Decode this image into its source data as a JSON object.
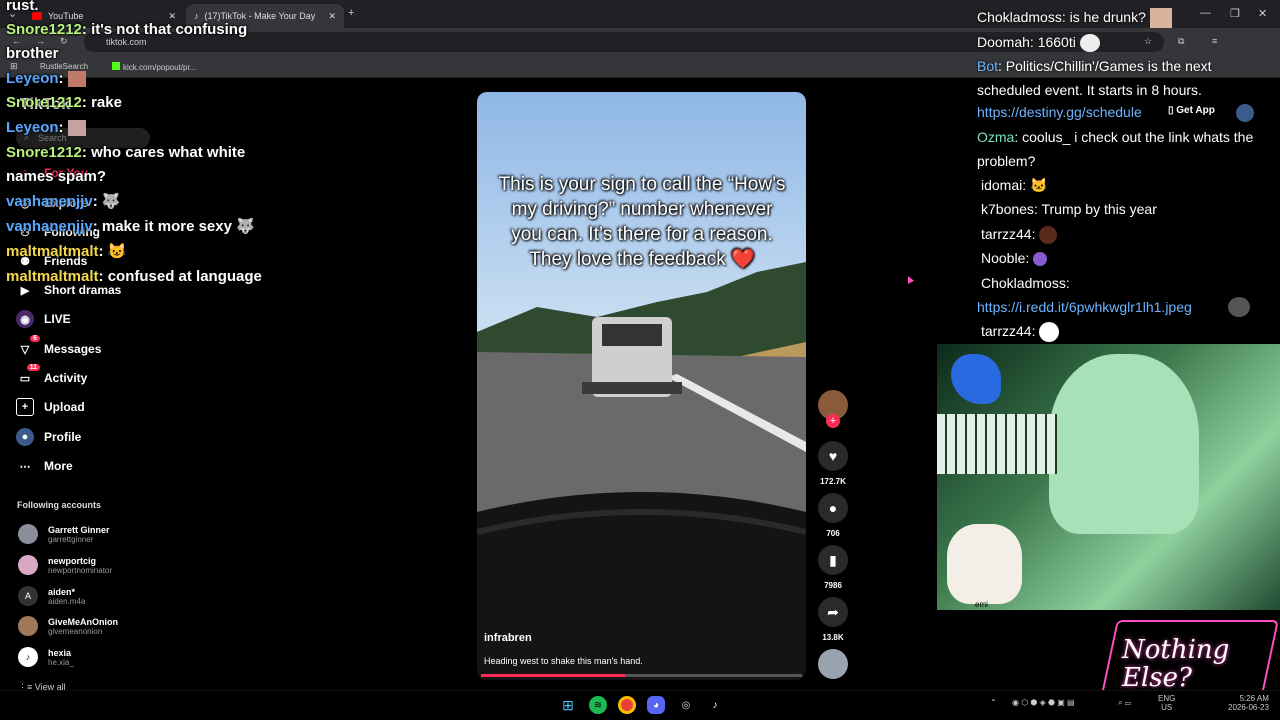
{
  "browser": {
    "tabs": [
      {
        "title": "YouTube",
        "active": false
      },
      {
        "title": "(17)TikTok - Make Your Day",
        "active": true
      }
    ],
    "url": "tiktok.com",
    "bookmarks": [
      "RustleSearch",
      "kick.com/popout/pr..."
    ],
    "get_app": "Get App"
  },
  "sidebar": {
    "brand": "TikTok",
    "search_placeholder": "Search",
    "items": [
      {
        "label": "For You",
        "icon": "home-icon"
      },
      {
        "label": "Explore",
        "icon": "compass-icon"
      },
      {
        "label": "Following",
        "icon": "following-icon"
      },
      {
        "label": "Friends",
        "icon": "friends-icon"
      },
      {
        "label": "Short dramas",
        "icon": "play-icon"
      },
      {
        "label": "LIVE",
        "icon": "live-icon"
      },
      {
        "label": "Messages",
        "icon": "messages-icon",
        "badge": "6"
      },
      {
        "label": "Activity",
        "icon": "activity-icon",
        "badge": "11"
      },
      {
        "label": "Upload",
        "icon": "upload-icon"
      },
      {
        "label": "Profile",
        "icon": "profile-icon"
      },
      {
        "label": "More",
        "icon": "more-icon"
      }
    ],
    "following_heading": "Following accounts",
    "accounts": [
      {
        "name": "Garrett Ginner",
        "handle": "garrettginner"
      },
      {
        "name": "newportcig",
        "handle": "newportnominator"
      },
      {
        "name": "aiden*",
        "handle": "aiden.m4a"
      },
      {
        "name": "GiveMeAnOnion",
        "handle": "givemeanonion"
      },
      {
        "name": "hexia",
        "handle": "he.xia_"
      }
    ],
    "view_all": "View all"
  },
  "left_chat": [
    {
      "user": "",
      "text": "rust.",
      "color": "#ffffff"
    },
    {
      "user": "Snore1212",
      "text": "it's not that confusing brother",
      "color": "#b9f27c"
    },
    {
      "user": "Leyeon",
      "text": "",
      "color": "#5aa7ff"
    },
    {
      "user": "Snore1212",
      "text": "rake",
      "color": "#b9f27c"
    },
    {
      "user": "Leyeon",
      "text": "",
      "color": "#5aa7ff"
    },
    {
      "user": "Snore1212",
      "text": "who cares what white names spam?",
      "color": "#b9f27c"
    },
    {
      "user": "vanhanenjjv",
      "text": "",
      "color": "#5aa7ff"
    },
    {
      "user": "vanhanenjjv",
      "text": "make it more sexy",
      "color": "#5aa7ff"
    },
    {
      "user": "maltmaltmalt",
      "text": "",
      "color": "#f5d84a"
    },
    {
      "user": "maltmaltmalt",
      "text": "confused at language",
      "color": "#f5d84a"
    }
  ],
  "video": {
    "caption": "This is your sign to call the “How’s my driving?” number whenever you can. It’s there for a reason. They love the feedback ❤️",
    "author": "infrabren",
    "description": "Heading west to shake this man's hand.",
    "likes": "172.7K",
    "comments": "706",
    "saves": "7986",
    "shares": "13.8K",
    "progress": 0.45
  },
  "right_chat": [
    {
      "user": "Chokladmoss",
      "text": "is he drunk?"
    },
    {
      "user": "Doomah",
      "text": "1660ti"
    },
    {
      "user": "Bot",
      "text": "Politics/Chillin'/Games is the next scheduled event. It starts in 8 hours."
    },
    {
      "user": "",
      "text": "https://destiny.gg/schedule",
      "link": true
    },
    {
      "user": "Ozma",
      "text": "coolus_ i check out the link whats the problem?"
    },
    {
      "user": "idomai",
      "text": ""
    },
    {
      "user": "k7bones",
      "text": "Trump by this year"
    },
    {
      "user": "tarrzz44",
      "text": ""
    },
    {
      "user": "Nooble",
      "text": ""
    },
    {
      "user": "Chokladmoss",
      "text": ""
    },
    {
      "user": "",
      "text": "https://i.redd.it/6pwhkwglr1lh1.jpeg",
      "link": true
    },
    {
      "user": "tarrzz44",
      "text": ""
    }
  ],
  "overlay": {
    "logo_text": "Nothing Else?",
    "cam_label": "emi"
  },
  "taskbar": {
    "lang": "ENG",
    "region": "US",
    "time": "5:26 AM",
    "date": "2026-06-23"
  },
  "colors": {
    "tiktok_red": "#fe2c55",
    "link_blue": "#6fb3ff",
    "overlay_pink": "#ff4fc3"
  }
}
